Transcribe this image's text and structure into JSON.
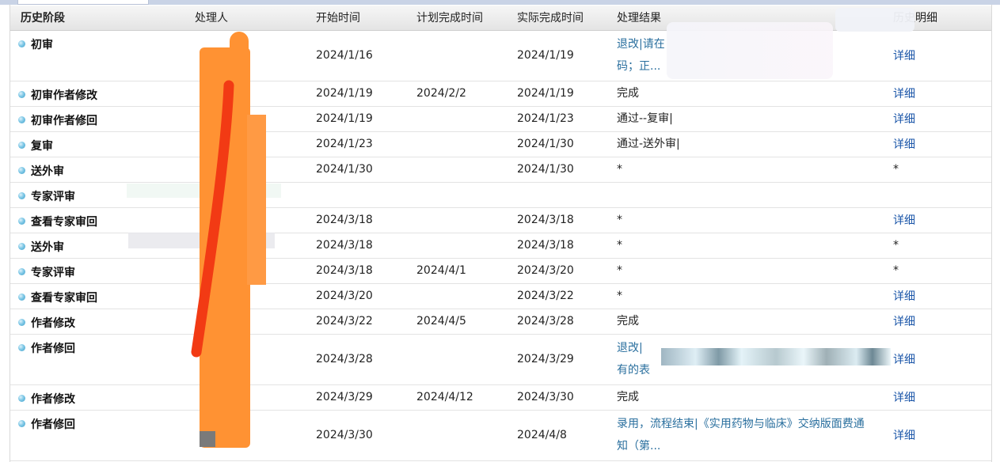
{
  "headers": {
    "stage": "历史阶段",
    "handler": "处理人",
    "start": "开始时间",
    "planned": "计划完成时间",
    "actual": "实际完成时间",
    "result": "处理结果",
    "detail": "历史明细"
  },
  "rows": [
    {
      "stage": "初审",
      "start": "2024/1/16",
      "planned": "",
      "actual": "2024/1/19",
      "result_line1": "退改|请在",
      "result_line2": "码；正...",
      "detail": "详细"
    },
    {
      "stage": "初审作者修改",
      "start": "2024/1/19",
      "planned": "2024/2/2",
      "actual": "2024/1/19",
      "result_line1": "完成",
      "result_line2": "",
      "detail": "详细"
    },
    {
      "stage": "初审作者修回",
      "start": "2024/1/19",
      "planned": "",
      "actual": "2024/1/23",
      "result_line1": "通过--复审|",
      "result_line2": "",
      "detail": "详细"
    },
    {
      "stage": "复审",
      "start": "2024/1/23",
      "planned": "",
      "actual": "2024/1/30",
      "result_line1": "通过-送外审|",
      "result_line2": "",
      "detail": "详细"
    },
    {
      "stage": "送外审",
      "start": "2024/1/30",
      "planned": "",
      "actual": "2024/1/30",
      "result_line1": "*",
      "result_line2": "",
      "detail": "*"
    },
    {
      "stage": "专家评审",
      "start": "",
      "planned": "",
      "actual": "",
      "result_line1": "",
      "result_line2": "",
      "detail": ""
    },
    {
      "stage": "查看专家审回",
      "start": "2024/3/18",
      "planned": "",
      "actual": "2024/3/18",
      "result_line1": "*",
      "result_line2": "",
      "detail": "详细"
    },
    {
      "stage": "送外审",
      "start": "2024/3/18",
      "planned": "",
      "actual": "2024/3/18",
      "result_line1": "*",
      "result_line2": "",
      "detail": "*"
    },
    {
      "stage": "专家评审",
      "start": "2024/3/18",
      "planned": "2024/4/1",
      "actual": "2024/3/20",
      "result_line1": "*",
      "result_line2": "",
      "detail": "*"
    },
    {
      "stage": "查看专家审回",
      "start": "2024/3/20",
      "planned": "",
      "actual": "2024/3/22",
      "result_line1": "*",
      "result_line2": "",
      "detail": "详细"
    },
    {
      "stage": "作者修改",
      "start": "2024/3/22",
      "planned": "2024/4/5",
      "actual": "2024/3/28",
      "result_line1": "完成",
      "result_line2": "",
      "detail": "详细"
    },
    {
      "stage": "作者修回",
      "start": "2024/3/28",
      "planned": "",
      "actual": "2024/3/29",
      "result_line1": "退改|",
      "result_line2": "有的表",
      "detail": "详细"
    },
    {
      "stage": "作者修改",
      "start": "2024/3/29",
      "planned": "2024/4/12",
      "actual": "2024/3/30",
      "result_line1": "完成",
      "result_line2": "",
      "detail": "详细"
    },
    {
      "stage": "作者修回",
      "start": "2024/3/30",
      "planned": "",
      "actual": "2024/4/8",
      "result_line1": "录用，流程结束|《实用药物与临床》交纳版面费通",
      "result_line2": "知（第...",
      "detail": "详细"
    }
  ]
}
